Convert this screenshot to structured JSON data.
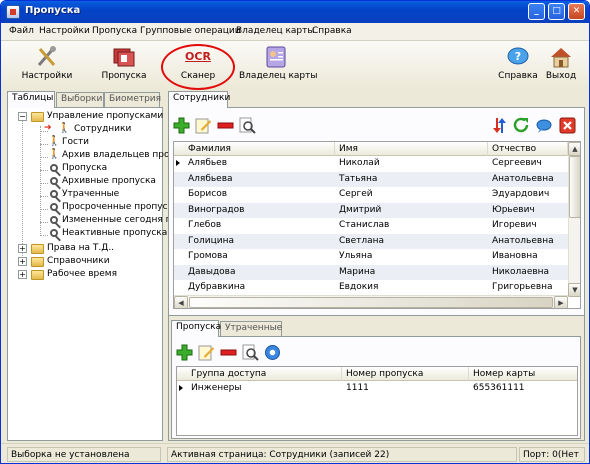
{
  "window": {
    "title": "Пропуска",
    "minimize": "_",
    "maximize": "□",
    "close": "✕"
  },
  "menu": [
    "Файл",
    "Настройки",
    "Пропуска",
    "Групповые операции",
    "Владелец карты",
    "Справка"
  ],
  "toolbar": {
    "settings": "Настройки",
    "passes": "Пропуска",
    "scanner": "Сканер",
    "scanner_icon_text": "OCR",
    "card_owner": "Владелец карты",
    "help": "Справка",
    "exit": "Выход"
  },
  "left_tabs": [
    "Таблицы",
    "Выборки",
    "Биометрия"
  ],
  "tree": {
    "root": "Управление пропусками",
    "children": [
      "Сотрудники",
      "Гости",
      "Архив владельцев про",
      "Пропуска",
      "Архивные пропуска",
      "Утраченные",
      "Просроченные пропуск",
      "Измененные сегодня пр",
      "Неактивные пропуска"
    ],
    "others": [
      "Права на Т.Д..",
      "Справочники",
      "Рабочее время"
    ]
  },
  "right_tab": "Сотрудники",
  "employees": {
    "columns": [
      "Фамилия",
      "Имя",
      "Отчество"
    ],
    "rows": [
      [
        "Алябьев",
        "Николай",
        "Сергеевич"
      ],
      [
        "Алябьева",
        "Татьяна",
        "Анатольевна"
      ],
      [
        "Борисов",
        "Сергей",
        "Эдуардович"
      ],
      [
        "Виноградов",
        "Дмитрий",
        "Юрьевич"
      ],
      [
        "Глебов",
        "Станислав",
        "Игоревич"
      ],
      [
        "Голицина",
        "Светлана",
        "Анатольевна"
      ],
      [
        "Громова",
        "Ульяна",
        "Ивановна"
      ],
      [
        "Давыдова",
        "Марина",
        "Николаевна"
      ],
      [
        "Дубравкина",
        "Евдокия",
        "Григорьевна"
      ]
    ]
  },
  "bottom_tabs": [
    "Пропуска",
    "Утраченные"
  ],
  "passes": {
    "columns": [
      "Группа доступа",
      "Номер пропуска",
      "Номер карты"
    ],
    "rows": [
      [
        "Инженеры",
        "1111",
        "655361111"
      ]
    ]
  },
  "status": {
    "left": "Выборка не установлена",
    "middle": "Активная страница: Сотрудники (записей 22)",
    "right": "Порт: 0(Нет"
  },
  "colors": {
    "accent": "#0a5fe0",
    "highlight": "#e30a0a",
    "row_alt": "#ebeef5"
  }
}
